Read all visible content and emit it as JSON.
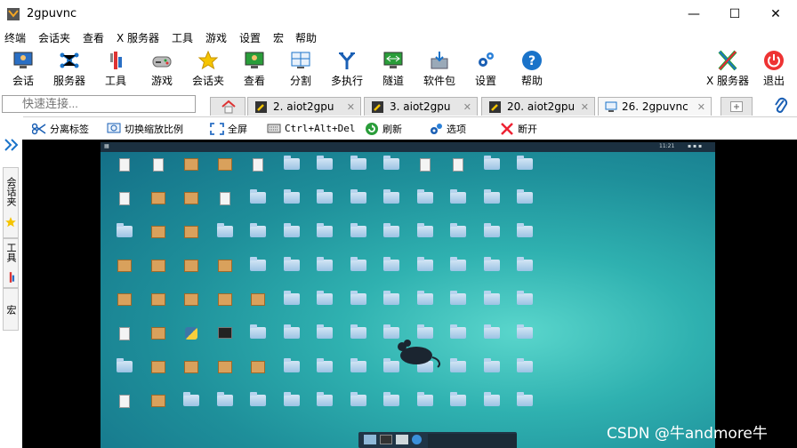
{
  "window": {
    "title": "2gpuvnc",
    "minimize": "—",
    "maximize": "☐",
    "close": "✕"
  },
  "menu": [
    "终端",
    "会话夹",
    "查看",
    "X 服务器",
    "工具",
    "游戏",
    "设置",
    "宏",
    "帮助"
  ],
  "toolbar": [
    {
      "label": "会话",
      "icon": "session-icon"
    },
    {
      "label": "服务器",
      "icon": "servers-icon"
    },
    {
      "label": "工具",
      "icon": "tools-icon"
    },
    {
      "label": "游戏",
      "icon": "games-icon"
    },
    {
      "label": "会话夹",
      "icon": "star-icon"
    },
    {
      "label": "查看",
      "icon": "view-icon"
    },
    {
      "label": "分割",
      "icon": "split-icon"
    },
    {
      "label": "多执行",
      "icon": "multiexec-icon"
    },
    {
      "label": "隧道",
      "icon": "tunnel-icon"
    },
    {
      "label": "软件包",
      "icon": "packages-icon"
    },
    {
      "label": "设置",
      "icon": "settings-icon"
    },
    {
      "label": "帮助",
      "icon": "help-icon"
    }
  ],
  "toolbar_right": [
    {
      "label": "X 服务器",
      "icon": "x-server-icon"
    },
    {
      "label": "退出",
      "icon": "power-icon"
    }
  ],
  "quick_connect": {
    "placeholder": "快速连接..."
  },
  "tabs": [
    {
      "label": "2. aiot2gpu"
    },
    {
      "label": "3. aiot2gpu"
    },
    {
      "label": "20. aiot2gpu"
    },
    {
      "label": "26. 2gpuvnc"
    }
  ],
  "subtoolbar": [
    {
      "label": "分离标签",
      "icon": "scissors-icon"
    },
    {
      "label": "切换缩放比例",
      "icon": "zoom-icon"
    },
    {
      "label": "全屏",
      "icon": "fullscreen-icon"
    },
    {
      "label": "Ctrl+Alt+Del",
      "icon": "keyboard-icon"
    },
    {
      "label": "刷新",
      "icon": "refresh-icon"
    },
    {
      "label": "选项",
      "icon": "options-icon"
    },
    {
      "label": "断开",
      "icon": "disconnect-icon"
    }
  ],
  "sidebar": [
    {
      "label": "会话夹"
    },
    {
      "label": "工具"
    },
    {
      "label": "宏"
    }
  ],
  "remote_desktop": {
    "clock": "11:21"
  },
  "watermark": "CSDN @牛andmore牛",
  "colors": {
    "accent": "#1a73c9",
    "desktop": "#1e8f9a"
  }
}
